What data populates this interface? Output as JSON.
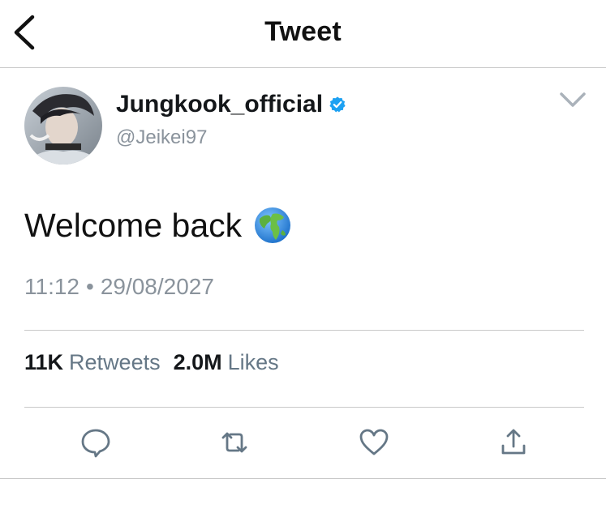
{
  "header": {
    "title": "Tweet"
  },
  "tweet": {
    "display_name": "Jungkook_official",
    "handle": "@Jeikei97",
    "verified": true,
    "text": "Welcome back",
    "emoji": "globe-emoji",
    "time": "11:12",
    "separator": "•",
    "date": "29/08/2027"
  },
  "stats": {
    "retweets_count": "11K",
    "retweets_label": "Retweets",
    "likes_count": "2.0M",
    "likes_label": "Likes"
  },
  "actions": [
    "reply-icon",
    "retweet-icon",
    "like-icon",
    "share-icon"
  ],
  "colors": {
    "accent": "#1da1f2",
    "muted": "#8a939c",
    "icon": "#657786",
    "divider": "#c9c9c9"
  }
}
